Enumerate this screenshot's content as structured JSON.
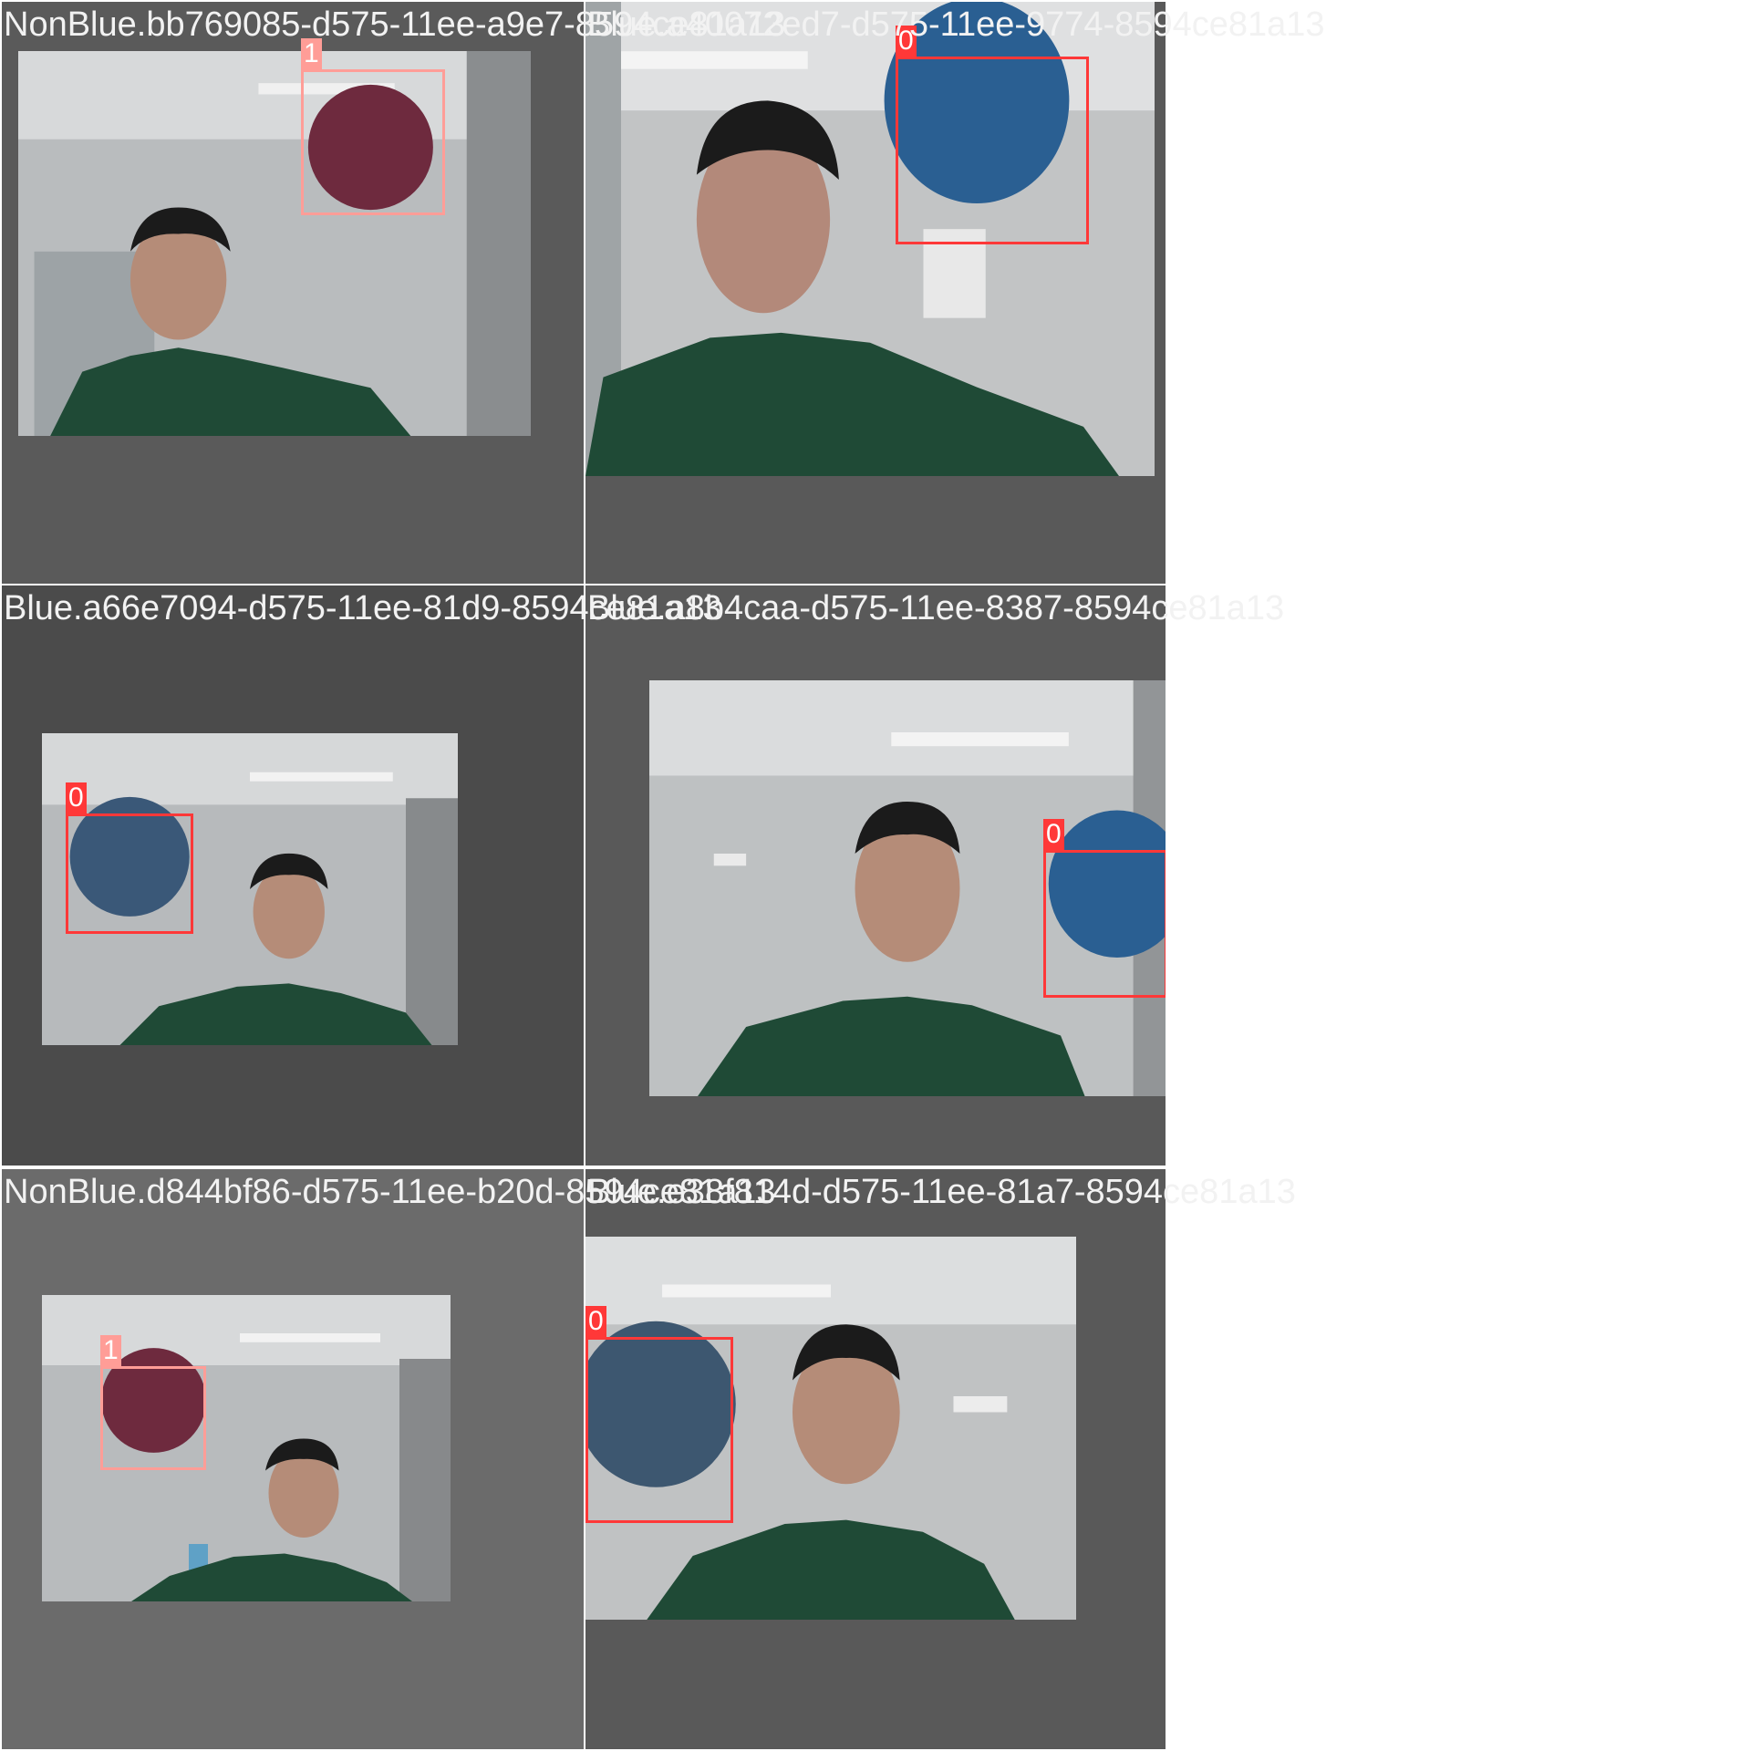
{
  "colors": {
    "divider": "#ffffff",
    "class_0": "#ff3838",
    "class_1": "#ff9d97",
    "label_text": "#ffffff",
    "filename_text": "#f2f2f2"
  },
  "tiles": [
    {
      "filename": "NonBlue.bb769085-d575-11ee-a9e7-8594ce81a13",
      "bg": "#5a5a5a",
      "class_label": "1",
      "ball_color": "#6e2a3e"
    },
    {
      "filename": "Blue.a40072ed7-d575-11ee-9774-8594ce81a13",
      "bg": "#595959",
      "class_label": "0",
      "ball_color": "#2a5f92"
    },
    {
      "filename": "Blue.a66e7094-d575-11ee-81d9-8594ce81a13",
      "bg": "#4b4b4b",
      "class_label": "0",
      "ball_color": "#3a5878"
    },
    {
      "filename": "Blue.a8b4caa-d575-11ee-8387-8594ce81a13",
      "bg": "#595959",
      "class_label": "0",
      "ball_color": "#2a5f92"
    },
    {
      "filename": "NonBlue.d844bf86-d575-11ee-b20d-8594ce81a13",
      "bg": "#6b6b6b",
      "class_label": "1",
      "ball_color": "#6e2a3e"
    },
    {
      "filename": "Blue.e38f814d-d575-11ee-81a7-8594ce81a13",
      "bg": "#595959",
      "class_label": "0",
      "ball_color": "#3d5770"
    }
  ]
}
